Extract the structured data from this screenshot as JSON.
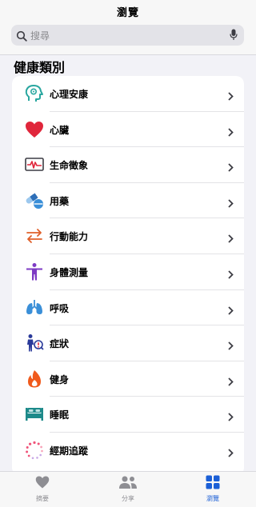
{
  "header": {
    "title": "瀏覽"
  },
  "search": {
    "placeholder": "搜尋"
  },
  "section": {
    "title": "健康類別"
  },
  "categories": [
    {
      "label": "心理安康",
      "icon": "mind-icon",
      "color": "#2aa7a0"
    },
    {
      "label": "心臟",
      "icon": "heart-icon",
      "color": "#e0263b"
    },
    {
      "label": "生命徵象",
      "icon": "vitals-icon",
      "color": "#e0263b"
    },
    {
      "label": "用藥",
      "icon": "pills-icon",
      "color": "#3a8fd8"
    },
    {
      "label": "行動能力",
      "icon": "mobility-icon",
      "color": "#e0602a"
    },
    {
      "label": "身體測量",
      "icon": "body-icon",
      "color": "#7d3ac4"
    },
    {
      "label": "呼吸",
      "icon": "lungs-icon",
      "color": "#3a8fd8"
    },
    {
      "label": "症狀",
      "icon": "symptoms-icon",
      "color": "#2a3a9a"
    },
    {
      "label": "健身",
      "icon": "flame-icon",
      "color": "#f05a1c"
    },
    {
      "label": "睡眠",
      "icon": "bed-icon",
      "color": "#1d8a8a"
    },
    {
      "label": "經期追蹤",
      "icon": "cycle-icon",
      "color": "#f0547a"
    }
  ],
  "tabs": [
    {
      "label": "摘要",
      "icon": "heart-icon",
      "active": false
    },
    {
      "label": "分享",
      "icon": "people-icon",
      "active": false
    },
    {
      "label": "瀏覽",
      "icon": "grid-icon",
      "active": true
    }
  ],
  "colors": {
    "accent": "#1b5fd6",
    "inactive": "#8e8e93"
  }
}
